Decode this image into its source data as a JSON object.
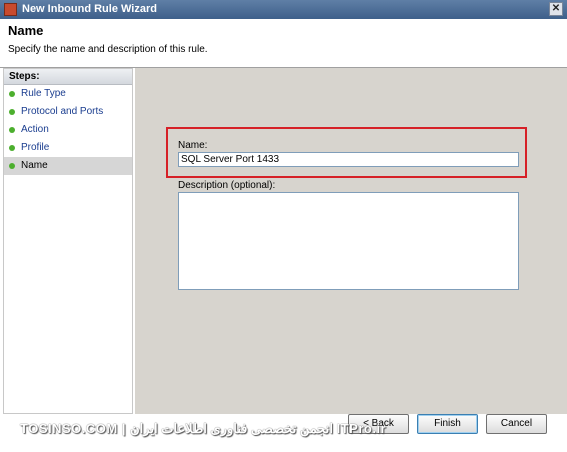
{
  "window": {
    "title": "New Inbound Rule Wizard",
    "close_glyph": "✕"
  },
  "header": {
    "title": "Name",
    "subtitle": "Specify the name and description of this rule."
  },
  "sidebar": {
    "heading": "Steps:",
    "items": [
      {
        "label": "Rule Type"
      },
      {
        "label": "Protocol and Ports"
      },
      {
        "label": "Action"
      },
      {
        "label": "Profile"
      },
      {
        "label": "Name",
        "active": true
      }
    ]
  },
  "form": {
    "name_label": "Name:",
    "name_value": "SQL Server Port 1433",
    "description_label": "Description (optional):",
    "description_value": ""
  },
  "buttons": {
    "back": "< Back",
    "finish": "Finish",
    "cancel": "Cancel"
  },
  "watermark": {
    "text": "TOSINSO.COM | انجمن تخصصی فناوری اطلاعات ایران ITPro.ir"
  },
  "colors": {
    "highlight": "#d62027",
    "step_dot": "#4caf2e",
    "title_bar": "#4a6b96"
  }
}
